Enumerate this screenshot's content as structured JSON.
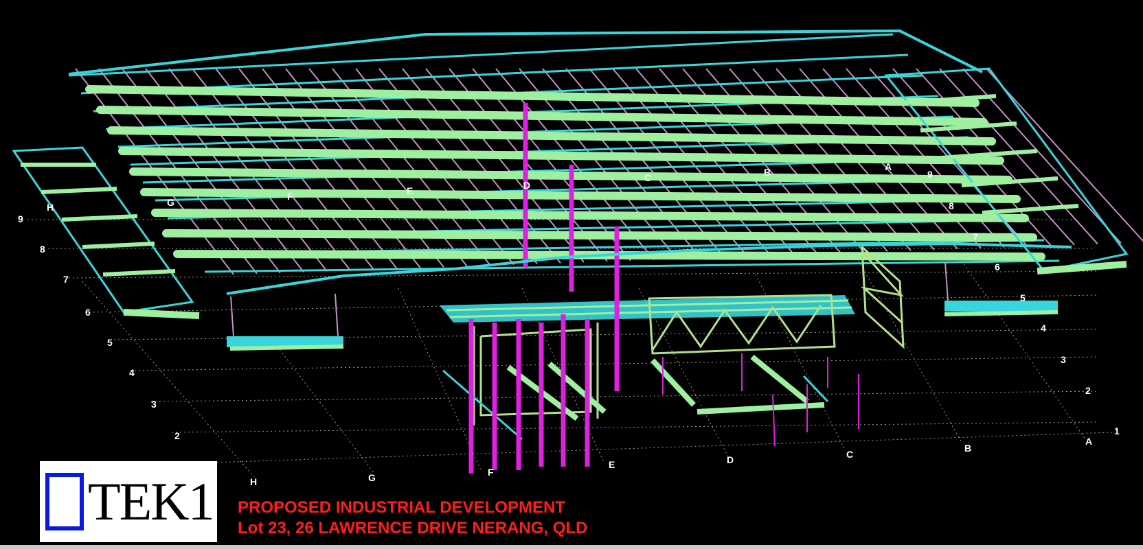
{
  "colors": {
    "background": "#000000",
    "beam_green": "#9ef0a0",
    "purlin_cyan": "#38d6dc",
    "rafter_pink": "#c890c8",
    "bracing_yellow": "#c8c880",
    "column_magenta": "#e020e0",
    "truss_olive": "#b4e08c",
    "caption_red": "#ff1d1d",
    "logo_blue": "#0a1adf"
  },
  "logo": {
    "text": "TEK1",
    "icon": "blue-square-icon"
  },
  "captions": [
    "PROPOSED INDUSTRIAL DEVELOPMENT",
    "Lot 23, 26 LAWRENCE DRIVE NERANG, QLD"
  ],
  "grid_labels": {
    "left_numbers": [
      "9",
      "8",
      "7",
      "6",
      "5",
      "4",
      "3",
      "2"
    ],
    "right_numbers": [
      "6",
      "5",
      "4",
      "3",
      "2",
      "1"
    ],
    "bottom_letters": [
      "H",
      "G",
      "F",
      "E",
      "D",
      "C",
      "B",
      "A"
    ],
    "roof_letters": [
      "H",
      "G",
      "F",
      "E",
      "D",
      "C",
      "B",
      "A"
    ],
    "roof_numbers": [
      "9",
      "8",
      "7"
    ]
  }
}
